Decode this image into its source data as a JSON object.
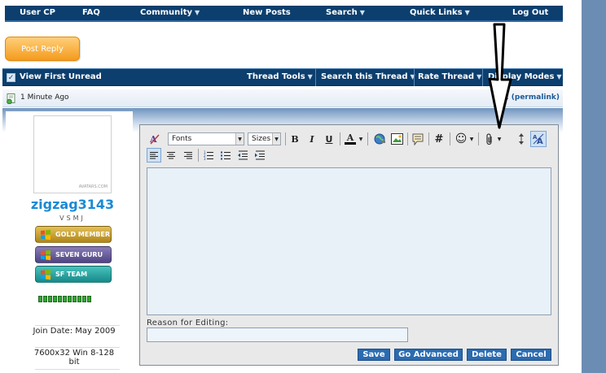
{
  "nav": {
    "items": [
      {
        "label": "User CP",
        "caret": false
      },
      {
        "label": "FAQ",
        "caret": false
      },
      {
        "label": "Community",
        "caret": true
      },
      {
        "label": "New Posts",
        "caret": false
      },
      {
        "label": "Search",
        "caret": true
      },
      {
        "label": "Quick Links",
        "caret": true
      },
      {
        "label": "Log Out",
        "caret": false
      }
    ]
  },
  "post_reply_label": "Post Reply",
  "threadbar": {
    "first_unread": "View First Unread",
    "thread_tools": "Thread Tools",
    "search_thread": "Search this Thread",
    "rate_thread": "Rate Thread",
    "display_modes": "Display Modes"
  },
  "post": {
    "time": "1 Minute Ago",
    "number": "#2",
    "permalink": "(permalink)"
  },
  "user": {
    "avatar_watermark": "AVATARS.COM",
    "name": "zigzag3143",
    "title": "VSMJ",
    "ranks": [
      "GOLD MEMBER",
      "SEVEN GURU",
      "SF TEAM"
    ],
    "rep_pips": 11,
    "join_date": "Join Date: May 2009",
    "system": "7600x32 Win 8-128 bit"
  },
  "editor": {
    "fonts_label": "Fonts",
    "sizes_label": "Sizes",
    "bold": "B",
    "italic": "I",
    "underline": "U",
    "font_color": "A",
    "hash": "#",
    "reason_label": "Reason for Editing:",
    "reason_value": "",
    "buttons": {
      "save": "Save",
      "go_advanced": "Go Advanced",
      "delete": "Delete",
      "cancel": "Cancel"
    }
  },
  "colors": {
    "nav_bg": "#0c3f6e",
    "accent": "#2b6bb0",
    "username": "#1a8ad6",
    "post_reply": "#f49b1d"
  }
}
